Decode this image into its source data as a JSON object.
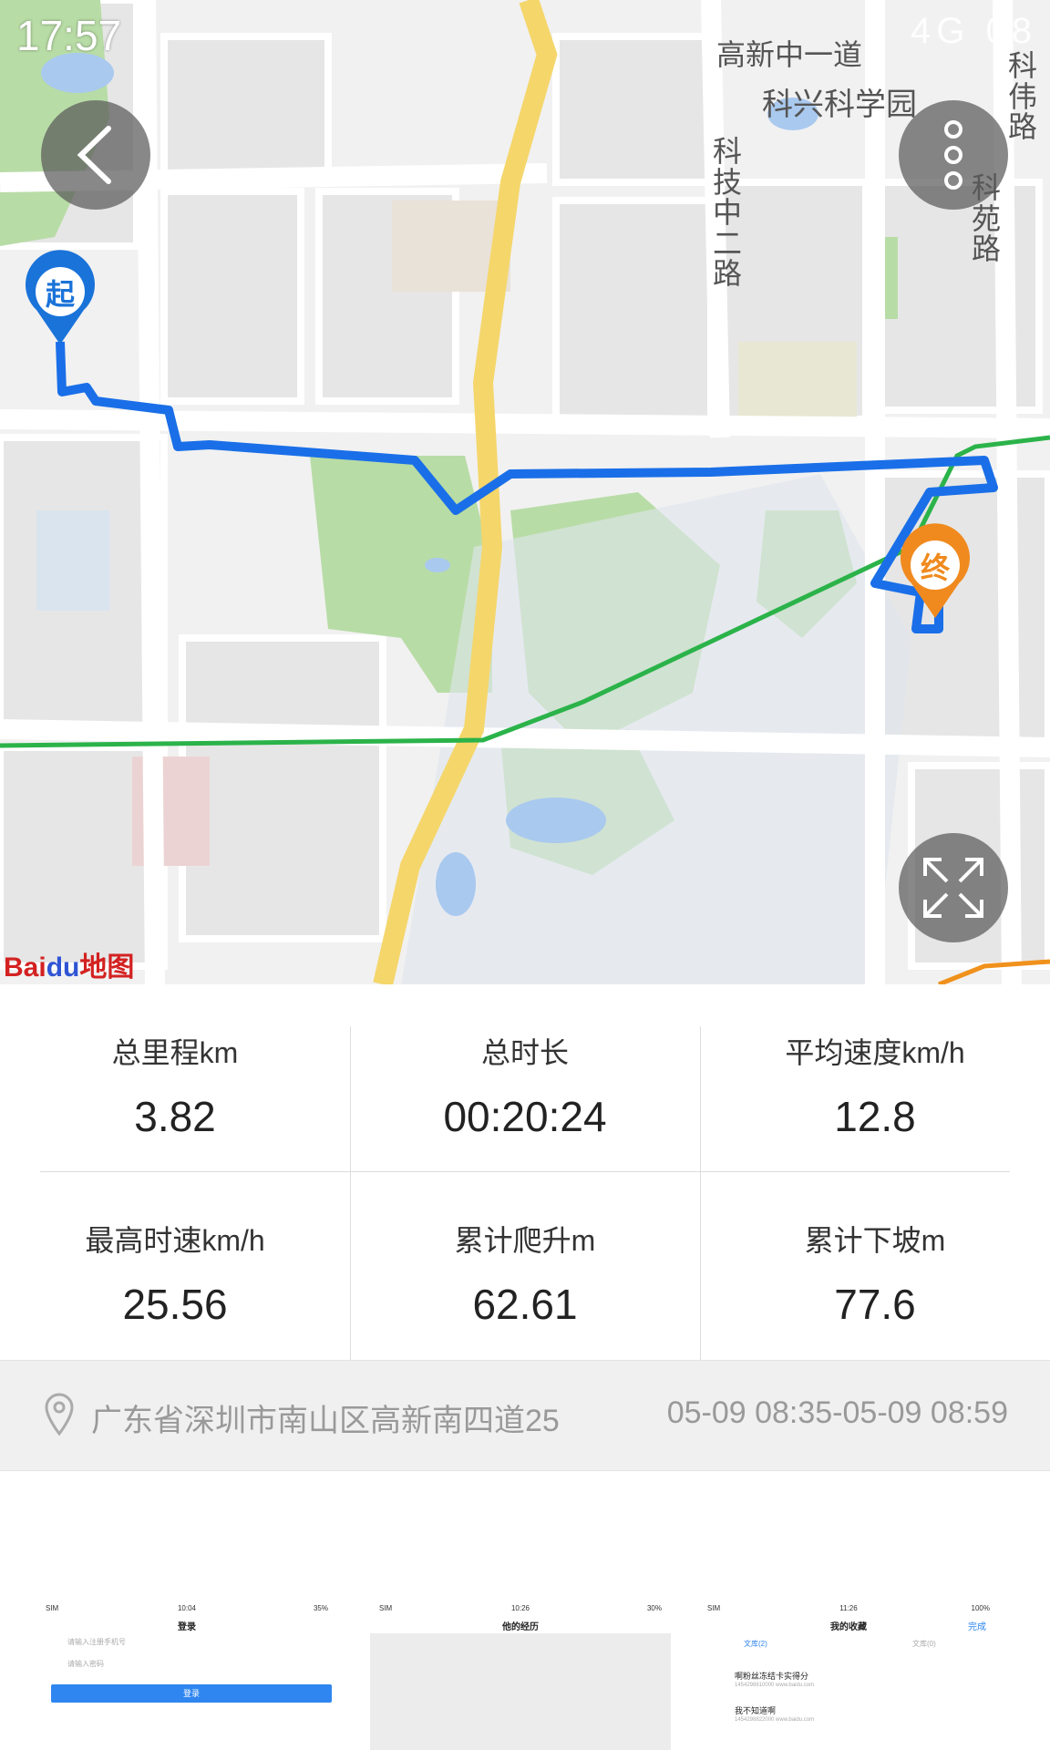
{
  "status_bar": {
    "time": "17:57",
    "right_text": "4G 08"
  },
  "map": {
    "labels": {
      "road_1": "高新中一道",
      "park": "科兴科学园",
      "road_2": "科伟路",
      "road_3": "科技中二路",
      "road_4": "科苑路"
    },
    "start_marker": "起",
    "end_marker": "终",
    "logo": {
      "text": "Bai",
      "paw": "du",
      "suffix": "地图"
    },
    "colors": {
      "route": "#1a6fe8",
      "metro": "#2bb34a",
      "highway": "#f5d66b",
      "start": "#1a73d9",
      "end": "#f08a1e"
    }
  },
  "buttons": {
    "back_icon": "chevron-left-icon",
    "more_icon": "more-vertical-icon",
    "fullscreen_icon": "expand-icon"
  },
  "stats": {
    "distance_label": "总里程km",
    "distance_value": "3.82",
    "duration_label": "总时长",
    "duration_value": "00:20:24",
    "avg_speed_label": "平均速度km/h",
    "avg_speed_value": "12.8",
    "max_speed_label": "最高时速km/h",
    "max_speed_value": "25.56",
    "climb_label": "累计爬升m",
    "climb_value": "62.61",
    "descent_label": "累计下坡m",
    "descent_value": "77.6"
  },
  "address": {
    "text": "广东省深圳市南山区高新南四道25",
    "time_range": "05-09 08:35-05-09 08:59"
  },
  "thumbnails": [
    {
      "time": "10:04",
      "battery": "35%",
      "title": "登录",
      "input_1": "请输入注册手机号",
      "input_2": "请输入密码",
      "button": "登录"
    },
    {
      "time": "10:26",
      "battery": "30%",
      "title": "他的经历"
    },
    {
      "time": "11:26",
      "battery": "100%",
      "title": "我的收藏",
      "action": "完成",
      "tab_1": "文库(2)",
      "tab_2": "文库(0)",
      "item_1": "啊粉丝冻结卡实得分",
      "item_1_sub": "1454298810000   www.baidu.com",
      "item_2": "我不知道啊",
      "item_2_sub": "1454298822000   www.baidu.com"
    }
  ]
}
